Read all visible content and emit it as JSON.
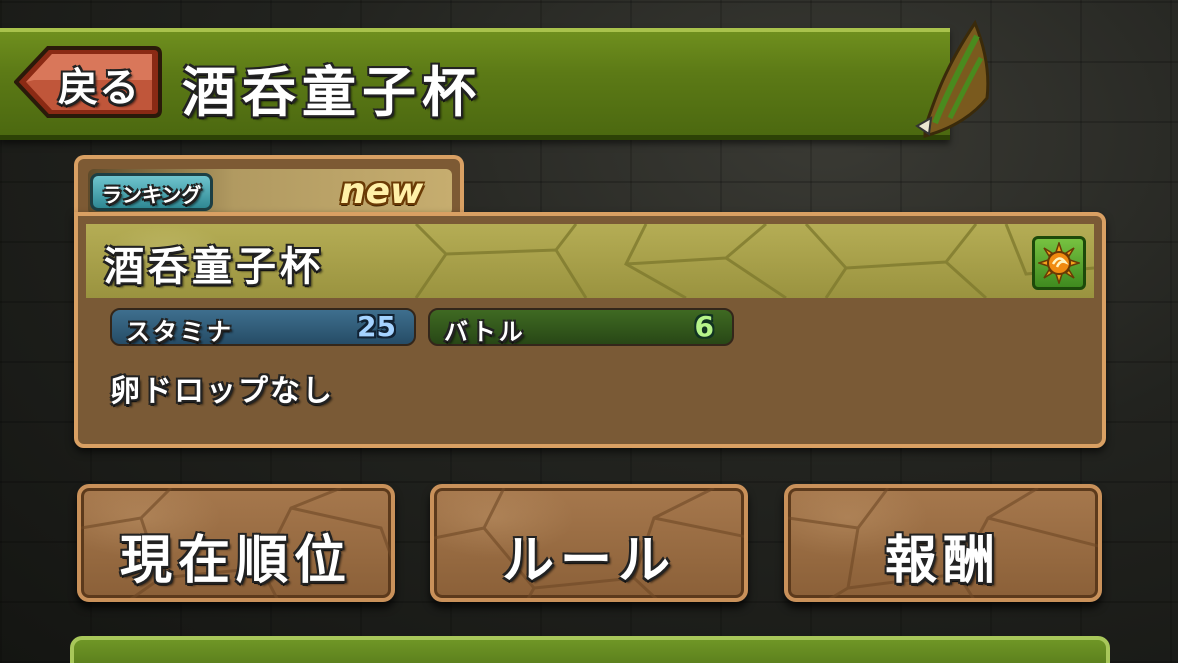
{
  "header": {
    "back_label": "戻る",
    "title": "酒呑童子杯"
  },
  "dungeon_card": {
    "tab_badge": "ランキング",
    "new_badge": "new",
    "title": "酒呑童子杯",
    "attribute_icon": "fire-sun-attribute-icon",
    "stamina_label": "スタミナ",
    "stamina_value": "25",
    "battle_label": "バトル",
    "battle_value": "6",
    "drop_note": "卵ドロップなし"
  },
  "buttons": {
    "rank": "現在順位",
    "rule": "ルール",
    "reward": "報酬"
  },
  "colors": {
    "header_green": "#5c7a16",
    "card_brown": "#7a5a36",
    "card_border": "#d9a063",
    "stamina_blue": "#264c66",
    "battle_green": "#284716"
  }
}
